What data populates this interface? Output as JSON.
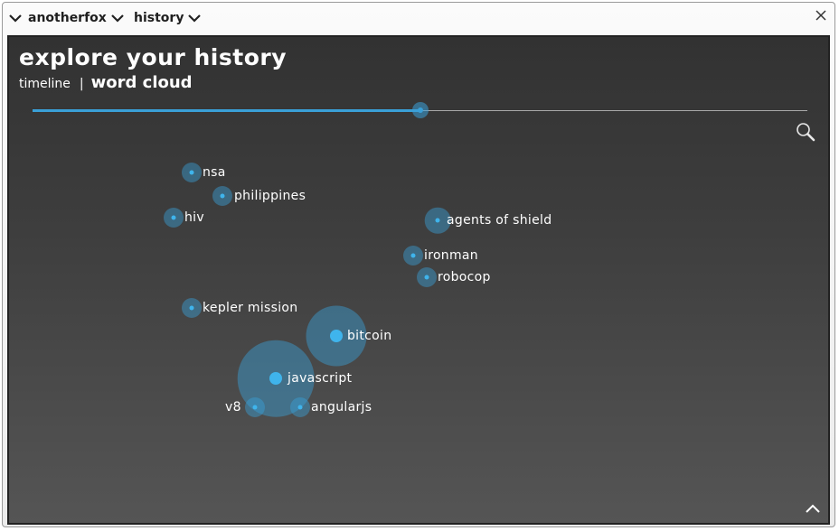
{
  "titlebar": {
    "crumbs": [
      {
        "label": "anotherfox",
        "icon": "chevron-down-icon"
      },
      {
        "label": "history",
        "icon": "chevron-down-icon"
      }
    ],
    "close_icon": "close-icon"
  },
  "panel": {
    "title": "explore your history",
    "views": {
      "timeline": "timeline",
      "separator": "|",
      "word_cloud": "word cloud",
      "active": "word cloud"
    },
    "slider": {
      "value_fraction": 0.5,
      "accent": "#3aa0d8"
    },
    "search_icon": "search-icon",
    "collapse_icon": "chevron-up-icon"
  },
  "word_cloud": {
    "words": [
      {
        "label": "nsa",
        "weight": 1
      },
      {
        "label": "philippines",
        "weight": 1
      },
      {
        "label": "hiv",
        "weight": 1
      },
      {
        "label": "agents of shield",
        "weight": 1.3
      },
      {
        "label": "ironman",
        "weight": 1
      },
      {
        "label": "robocop",
        "weight": 1
      },
      {
        "label": "kepler mission",
        "weight": 1
      },
      {
        "label": "bitcoin",
        "weight": 2.5
      },
      {
        "label": "javascript",
        "weight": 3.3
      },
      {
        "label": "v8",
        "weight": 1
      },
      {
        "label": "angularjs",
        "weight": 1
      }
    ]
  }
}
